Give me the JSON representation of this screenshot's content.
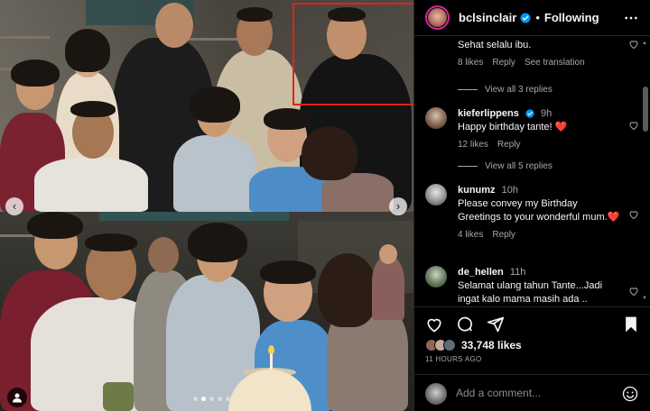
{
  "post": {
    "author": "bclsinclair",
    "separator": "•",
    "follow_label": "Following",
    "likes_count": "33,748 likes",
    "time_ago": "11 HOURS AGO",
    "add_comment_placeholder": "Add a comment...",
    "carousel": {
      "total": 5,
      "current": 2
    }
  },
  "comments": [
    {
      "user": "",
      "time": "",
      "text": "Sehat selalu ibu.",
      "likes": "8 likes",
      "reply": "Reply",
      "extra": "See translation",
      "view_replies": "View all 3 replies",
      "heart": false
    },
    {
      "user": "kieferlippens",
      "time": "9h",
      "text": "Happy birthday tante! ❤️",
      "likes": "12 likes",
      "reply": "Reply",
      "extra": "",
      "view_replies": "View all 5 replies",
      "heart": false,
      "verified": true
    },
    {
      "user": "kunumz",
      "time": "10h",
      "text": "Please convey my Birthday Greetings to your wonderful mum.❤️",
      "likes": "4 likes",
      "reply": "Reply",
      "extra": "",
      "view_replies": "",
      "heart": false
    },
    {
      "user": "de_hellen",
      "time": "11h",
      "text": "Selamat ulang tahun Tante...Jadi ingat kalo mama masih ada ..",
      "likes": "",
      "reply": "",
      "extra": "",
      "view_replies": "",
      "heart": false
    }
  ],
  "colors": {
    "verified": "#0095f6",
    "highlight": "#e0221c",
    "story_ring": "#d6249f",
    "heart_red": "#ff3040"
  },
  "icons": [
    "heart-icon",
    "comment-icon",
    "share-icon",
    "bookmark-icon",
    "more-icon",
    "emoji-icon",
    "verified-icon",
    "user-tag-icon",
    "chevron-left-icon",
    "chevron-right-icon"
  ]
}
